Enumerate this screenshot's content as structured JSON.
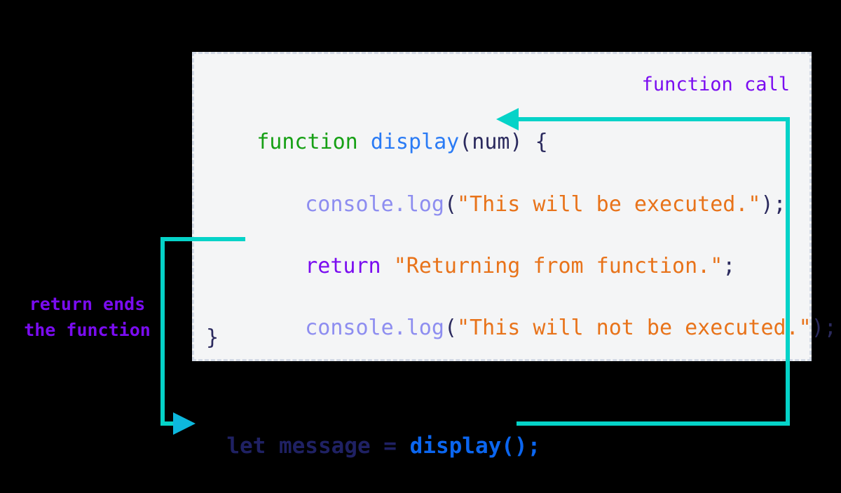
{
  "diagram": {
    "title_label": "function call",
    "annotation": "return ends\nthe function",
    "background_color": "#000000",
    "panel_background": "#f4f5f6",
    "panel_border_color": "#d3dae6",
    "arrow_color_call": "#05d3c8",
    "arrow_color_return": "#00b2dd"
  },
  "code": {
    "line1": {
      "keyword": "function",
      "space1": " ",
      "name": "display",
      "args": "(num) {"
    },
    "line2": {
      "method": "console.log",
      "open": "(",
      "string": "\"This will be executed.\"",
      "close": ");"
    },
    "line3": {
      "keyword": "return",
      "space": " ",
      "string": "\"Returning from function.\"",
      "close": ";"
    },
    "line4": {
      "method": "console.log",
      "open": "(",
      "string": "\"This will not be executed.\"",
      "close": ");"
    },
    "line5": {
      "brace": "}"
    }
  },
  "call": {
    "declaration": "let message = ",
    "invocation": "display();"
  }
}
